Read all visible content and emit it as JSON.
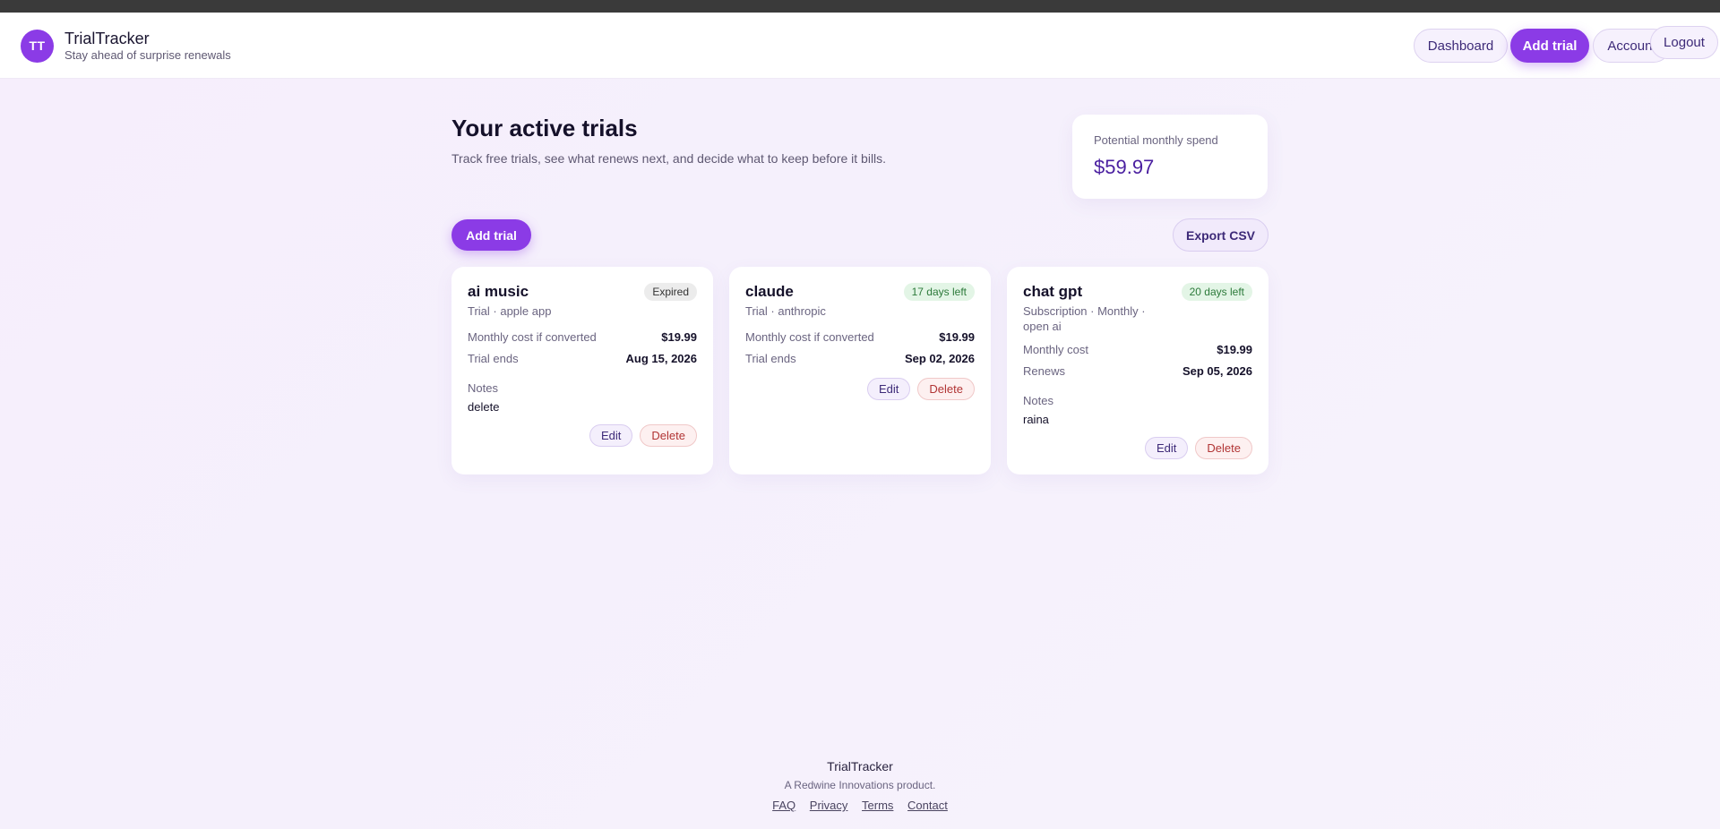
{
  "brand": {
    "initials": "TT",
    "name": "TrialTracker",
    "tagline": "Stay ahead of surprise renewals"
  },
  "nav": {
    "dashboard": "Dashboard",
    "add_trial": "Add trial",
    "account": "Account",
    "logout": "Logout"
  },
  "page": {
    "title": "Your active trials",
    "subtitle": "Track free trials, see what renews next, and decide what to keep before it bills."
  },
  "spend": {
    "label": "Potential monthly spend",
    "value": "$59.97"
  },
  "toolbar": {
    "add_trial": "Add trial",
    "export_csv": "Export CSV"
  },
  "cards": [
    {
      "title": "ai music",
      "badge": "Expired",
      "meta": "Trial · apple app",
      "row1_label": "Monthly cost if converted",
      "row1_value": "$19.99",
      "row2_label": "Trial ends",
      "row2_value": "Aug 15, 2026",
      "notes_label": "Notes",
      "notes": "delete",
      "edit": "Edit",
      "delete": "Delete"
    },
    {
      "title": "claude",
      "badge": "17 days left",
      "meta": "Trial · anthropic",
      "row1_label": "Monthly cost if converted",
      "row1_value": "$19.99",
      "row2_label": "Trial ends",
      "row2_value": "Sep 02, 2026",
      "edit": "Edit",
      "delete": "Delete"
    },
    {
      "title": "chat gpt",
      "badge": "20 days left",
      "meta_line1": "Subscription · Monthly ·",
      "meta_line2": "open ai",
      "row1_label": "Monthly cost",
      "row1_value": "$19.99",
      "row2_label": "Renews",
      "row2_value": "Sep 05, 2026",
      "notes_label": "Notes",
      "notes": "raina",
      "edit": "Edit",
      "delete": "Delete"
    }
  ],
  "footer": {
    "name": "TrialTracker",
    "sub": "A Redwine Innovations product.",
    "links": [
      "FAQ",
      "Privacy",
      "Terms",
      "Contact"
    ]
  },
  "colors": {
    "accent": "#8b3be6",
    "spend_value": "#4a1fa0",
    "badge_ok_bg": "#e3f5e6",
    "badge_ok_text": "#2c7a3a",
    "delete_text": "#b13434"
  }
}
